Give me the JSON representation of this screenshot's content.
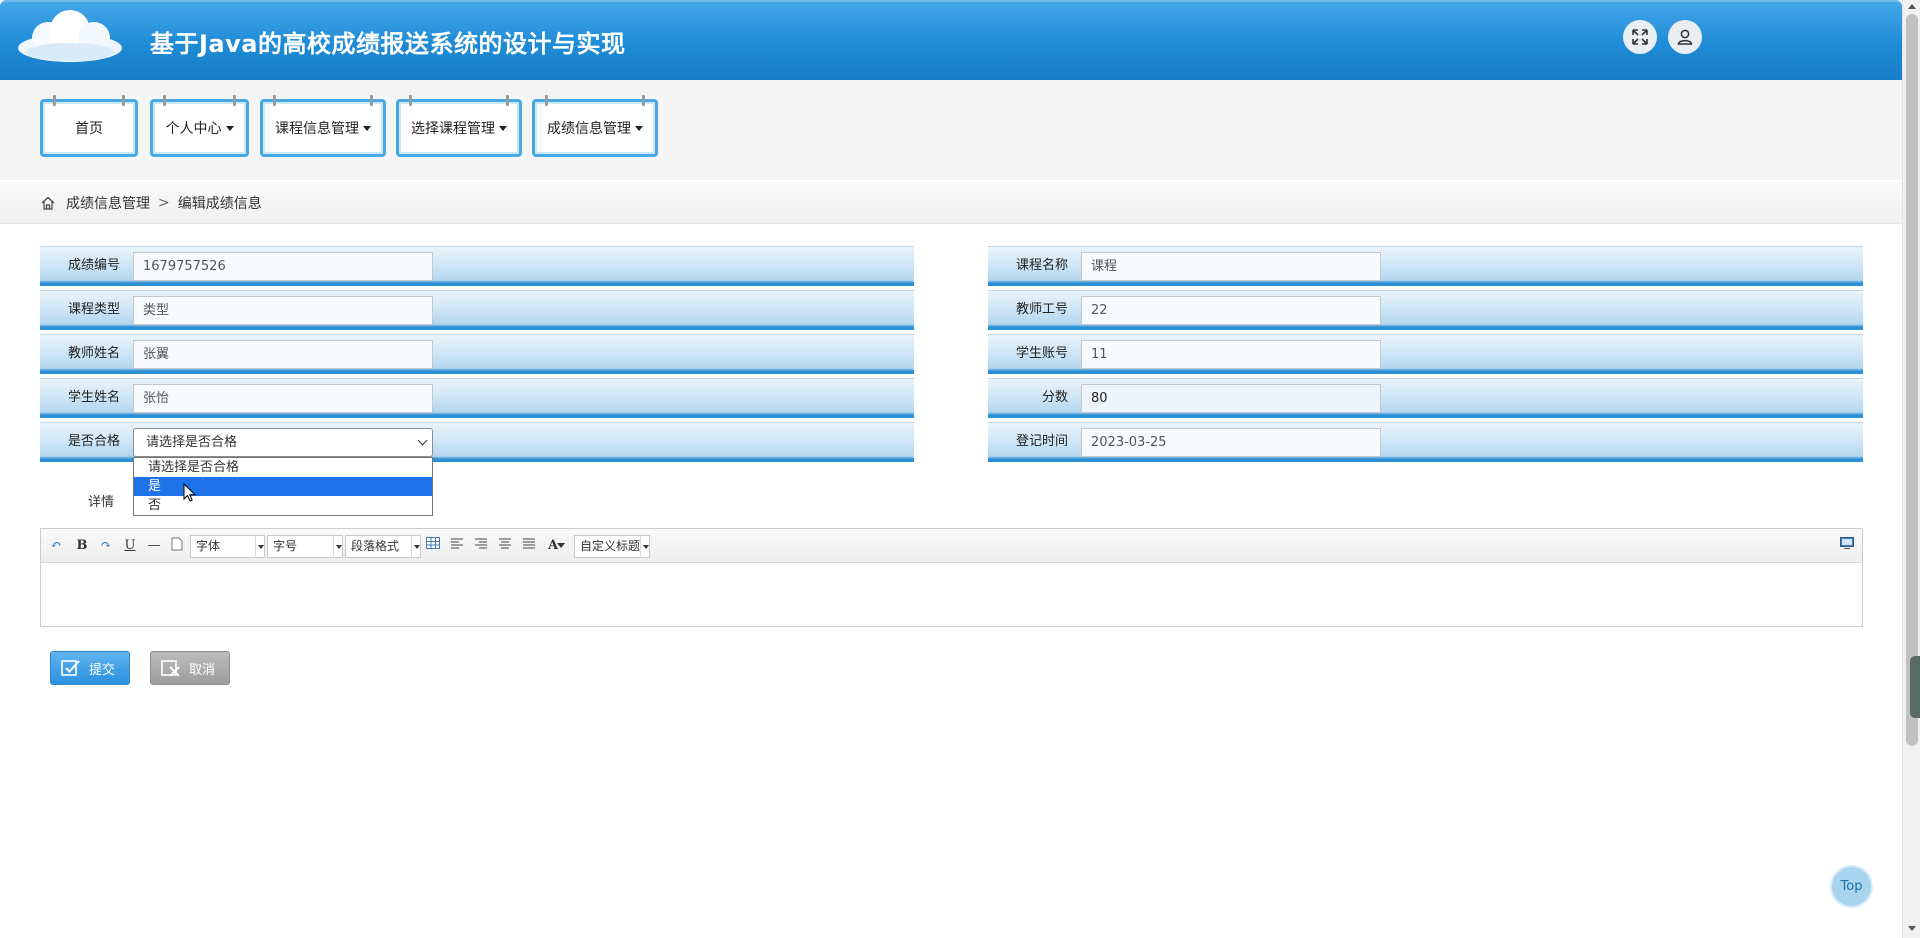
{
  "header": {
    "title": "基于Java的高校成绩报送系统的设计与实现",
    "fullscreen_icon": "expand-icon",
    "user_icon": "user-icon"
  },
  "nav": {
    "items": [
      {
        "label": "首页",
        "has_caret": false
      },
      {
        "label": "个人中心",
        "has_caret": true
      },
      {
        "label": "课程信息管理",
        "has_caret": true
      },
      {
        "label": "选择课程管理",
        "has_caret": true
      },
      {
        "label": "成绩信息管理",
        "has_caret": true
      }
    ]
  },
  "breadcrumb": {
    "section": "成绩信息管理",
    "separator": ">",
    "page": "编辑成绩信息"
  },
  "form": {
    "score_no": {
      "label": "成绩编号",
      "value": "1679757526"
    },
    "course_name": {
      "label": "课程名称",
      "value": "课程"
    },
    "course_type": {
      "label": "课程类型",
      "value": "类型"
    },
    "teacher_no": {
      "label": "教师工号",
      "value": "22"
    },
    "teacher_name": {
      "label": "教师姓名",
      "value": "张翼"
    },
    "student_account": {
      "label": "学生账号",
      "value": "11"
    },
    "student_name": {
      "label": "学生姓名",
      "value": "张怡"
    },
    "score": {
      "label": "分数",
      "value": "80"
    },
    "passed": {
      "label": "是否合格",
      "selected": "请选择是否合格",
      "options": [
        "请选择是否合格",
        "是",
        "否"
      ],
      "highlighted": "是"
    },
    "record_time": {
      "label": "登记时间",
      "value": "2023-03-25"
    },
    "detail": {
      "label": "详情"
    }
  },
  "editor": {
    "font_family": "字体",
    "font_size": "字号",
    "paragraph": "段落格式",
    "custom_title": "自定义标题",
    "bold": "B",
    "underline": "U",
    "font_color": "A"
  },
  "buttons": {
    "submit": "提交",
    "cancel": "取消"
  },
  "scroll_top": "Top",
  "colors": {
    "header_blue": "#1f8bd6",
    "nav_border": "#48a8e6",
    "submit_blue": "#2b90de",
    "cancel_gray": "#9d9d9d",
    "option_highlight": "#1e73e8"
  }
}
